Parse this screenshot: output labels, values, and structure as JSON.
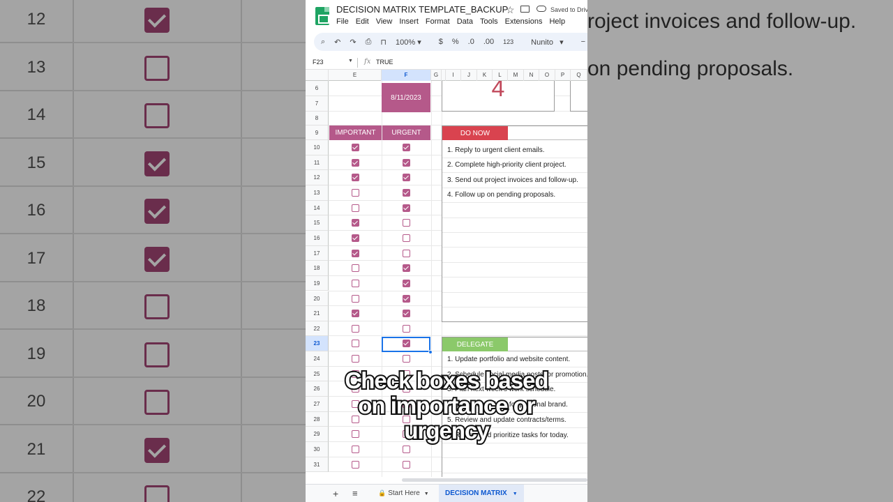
{
  "background": {
    "row_numbers": [
      "12",
      "13",
      "14",
      "15",
      "16",
      "17",
      "18",
      "19",
      "20",
      "21",
      "22"
    ],
    "checks": [
      true,
      false,
      false,
      true,
      true,
      true,
      false,
      false,
      false,
      true,
      false
    ],
    "text_lines": [
      "roject invoices and follow-up.",
      "on pending proposals."
    ]
  },
  "app": {
    "title": "DECISION MATRIX TEMPLATE_BACKUP",
    "saved_status": "Saved to Driv",
    "menu": [
      "File",
      "Edit",
      "View",
      "Insert",
      "Format",
      "Data",
      "Tools",
      "Extensions",
      "Help"
    ],
    "toolbar": {
      "zoom": "100%",
      "currency": "$",
      "percent": "%",
      "dec_decrease": ".0",
      "dec_increase": ".00",
      "number_format": "123",
      "font": "Nunito"
    },
    "formula_bar": {
      "cell_ref": "F23",
      "value": "TRUE"
    },
    "columns": [
      "E",
      "F",
      "G",
      "I",
      "J",
      "K",
      "L",
      "M",
      "N",
      "O",
      "P",
      "Q"
    ],
    "rows": [
      "6",
      "7",
      "8",
      "9",
      "10",
      "11",
      "12",
      "13",
      "14",
      "15",
      "16",
      "17",
      "18",
      "19",
      "20",
      "21",
      "22",
      "23",
      "24",
      "25",
      "26",
      "27",
      "28",
      "29",
      "30",
      "31"
    ],
    "date": "8/11/2023",
    "count": "4",
    "headers": {
      "important": "IMPORTANT",
      "urgent": "URGENT"
    },
    "checkboxes": {
      "important": [
        true,
        true,
        true,
        false,
        false,
        true,
        true,
        true,
        false,
        false,
        false,
        true,
        false,
        false,
        false,
        false,
        false,
        false,
        false,
        false,
        false,
        false
      ],
      "urgent": [
        true,
        true,
        true,
        true,
        true,
        false,
        false,
        false,
        true,
        true,
        true,
        true,
        false,
        true,
        false,
        false,
        false,
        false,
        false,
        false,
        false,
        false
      ]
    },
    "do_now": {
      "label": "DO NOW",
      "tasks": [
        "1. Reply to urgent client emails.",
        "2. Complete high-priority client project.",
        "3. Send out project invoices and follow-up.",
        "4. Follow up on pending proposals."
      ]
    },
    "delegate": {
      "label": "DELEGATE",
      "tasks": [
        "1. Update portfolio and website content.",
        "2. Schedule social media posts for promotion.",
        "3. Plan next week's work schedule.",
        "4. Brainstorm ideas for personal brand.",
        "5. Review and update contracts/terms.",
        "6. Review and prioritize tasks for today."
      ]
    },
    "sheet_tabs": {
      "start": "Start Here",
      "active": "DECISION MATRIX"
    }
  },
  "caption": [
    "Check boxes based",
    "on importance or",
    "urgency"
  ]
}
